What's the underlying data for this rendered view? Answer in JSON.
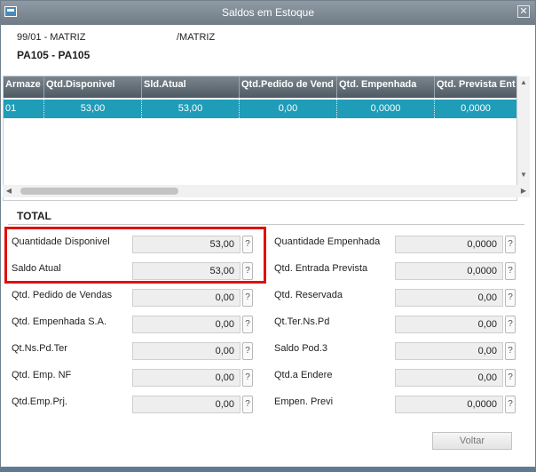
{
  "window": {
    "title": "Saldos em Estoque"
  },
  "header": {
    "branch": "99/01 - MATRIZ",
    "branch_name": "/MATRIZ",
    "product": "PA105 - PA105"
  },
  "grid": {
    "columns": [
      "Armaze",
      "Qtd.Disponivel",
      "Sld.Atual",
      "Qtd.Pedido de Vend",
      "Qtd. Empenhada",
      "Qtd. Prevista Ent"
    ],
    "rows": [
      [
        "01",
        "53,00",
        "53,00",
        "0,00",
        "0,0000",
        "0,0000"
      ]
    ]
  },
  "total": {
    "heading": "TOTAL",
    "left": [
      {
        "label": "Quantidade Disponivel",
        "value": "53,00"
      },
      {
        "label": "Saldo Atual",
        "value": "53,00"
      },
      {
        "label": "Qtd. Pedido de Vendas",
        "value": "0,00"
      },
      {
        "label": "Qtd. Empenhada S.A.",
        "value": "0,00"
      },
      {
        "label": "Qt.Ns.Pd.Ter",
        "value": "0,00"
      },
      {
        "label": "Qtd. Emp. NF",
        "value": "0,00"
      },
      {
        "label": "Qtd.Emp.Prj.",
        "value": "0,00"
      }
    ],
    "right": [
      {
        "label": "Quantidade Empenhada",
        "value": "0,0000"
      },
      {
        "label": "Qtd. Entrada Prevista",
        "value": "0,0000"
      },
      {
        "label": "Qtd. Reservada",
        "value": "0,00"
      },
      {
        "label": "Qt.Ter.Ns.Pd",
        "value": "0,00"
      },
      {
        "label": "Saldo Pod.3",
        "value": "0,00"
      },
      {
        "label": "Qtd.a Endere",
        "value": "0,00"
      },
      {
        "label": "Empen. Previ",
        "value": "0,0000"
      }
    ],
    "help_glyph": "?"
  },
  "buttons": {
    "back": "Voltar"
  },
  "icons": {
    "close": "✕",
    "scroll_up": "▲",
    "scroll_down": "▼",
    "scroll_left": "◀",
    "scroll_right": "▶"
  },
  "colors": {
    "highlight": "#e01010",
    "selected_row": "#1f9cb8"
  }
}
